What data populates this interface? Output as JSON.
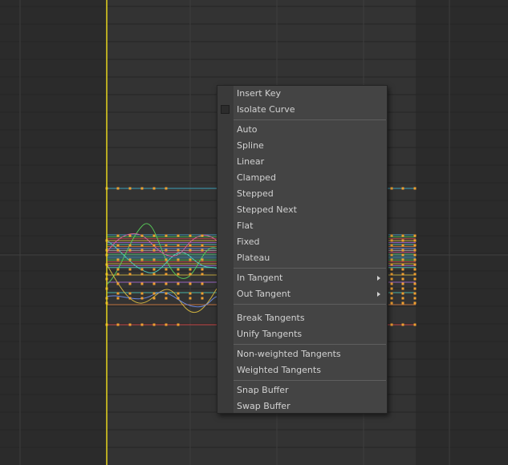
{
  "menu": {
    "insert_key": "Insert Key",
    "isolate_curve": "Isolate Curve",
    "isolate_curve_checked": false,
    "auto": "Auto",
    "spline": "Spline",
    "linear": "Linear",
    "clamped": "Clamped",
    "stepped": "Stepped",
    "stepped_next": "Stepped Next",
    "flat": "Flat",
    "fixed": "Fixed",
    "plateau": "Plateau",
    "in_tangent": "In Tangent",
    "out_tangent": "Out Tangent",
    "break_tangents": "Break Tangents",
    "unify_tangents": "Unify Tangents",
    "non_weighted_tangents": "Non-weighted Tangents",
    "weighted_tangents": "Weighted Tangents",
    "snap_buffer": "Snap Buffer",
    "swap_buffer": "Swap Buffer"
  },
  "colors": {
    "background": "#2b2b2b",
    "time_range": "#333333",
    "current_time_line": "#e6d51e",
    "key": "#f0a030",
    "menu_bg": "#444444",
    "menu_text": "#d2d2d2"
  }
}
